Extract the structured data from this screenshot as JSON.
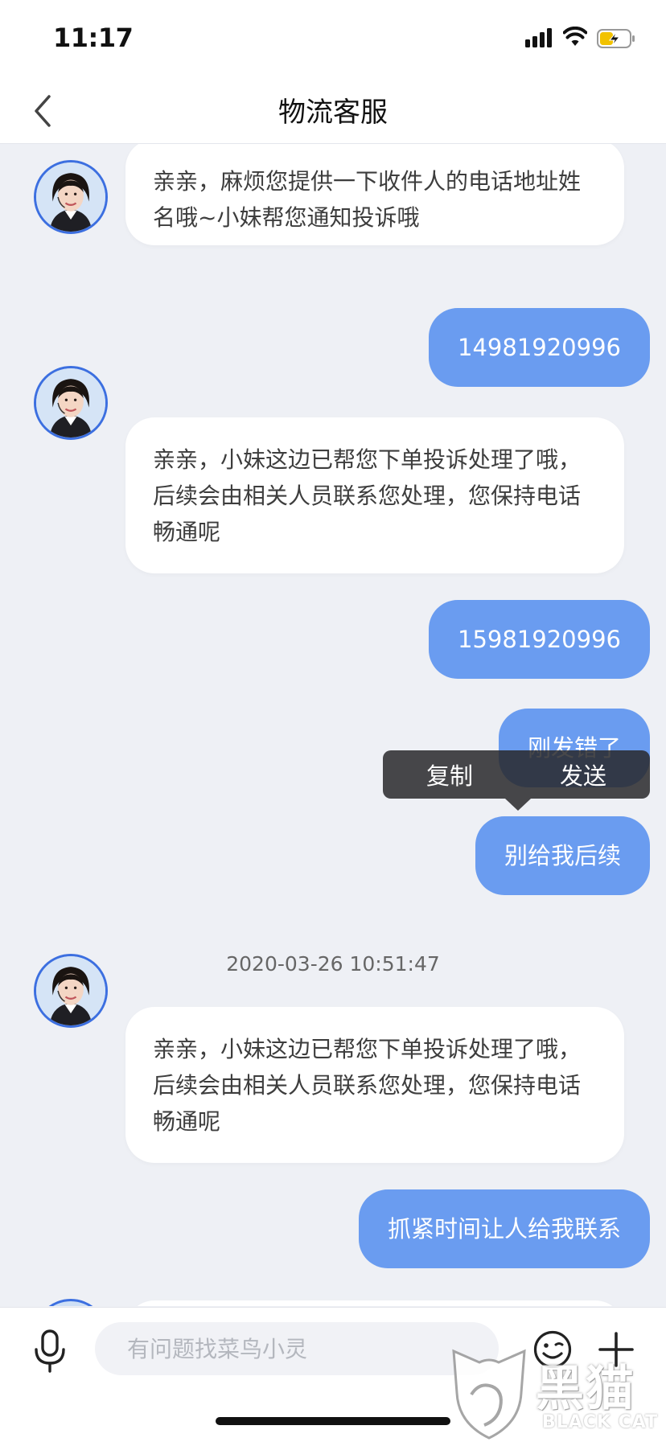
{
  "status_bar": {
    "time": "11:17"
  },
  "nav": {
    "title": "物流客服"
  },
  "messages": [
    {
      "side": "in",
      "text": "亲亲，麻烦您提供一下收件人的电话地址姓名哦~小妹帮您通知投诉哦"
    },
    {
      "side": "out",
      "text": "14981920996"
    },
    {
      "side": "in",
      "text": "亲亲，小妹这边已帮您下单投诉处理了哦，后续会由相关人员联系您处理，您保持电话畅通呢"
    },
    {
      "side": "out",
      "text": "15981920996"
    },
    {
      "side": "out",
      "text": "刚发错了"
    },
    {
      "side": "out",
      "text": "别给我后续"
    },
    {
      "side": "in",
      "text": "亲亲，小妹这边已帮您下单投诉处理了哦，后续会由相关人员联系您处理，您保持电话畅通呢"
    },
    {
      "side": "out",
      "text": "抓紧时间让人给我联系"
    }
  ],
  "timestamp": "2020-03-26 10:51:47",
  "context_menu": {
    "copy": "复制",
    "send": "发送"
  },
  "input": {
    "placeholder": "有问题找菜鸟小灵"
  },
  "watermark": {
    "cn": "黑猫",
    "en": "BLACK CAT"
  },
  "colors": {
    "bubble_out": "#6a9cf0",
    "avatar_ring": "#3c6fe0",
    "background": "#eef0f5"
  }
}
